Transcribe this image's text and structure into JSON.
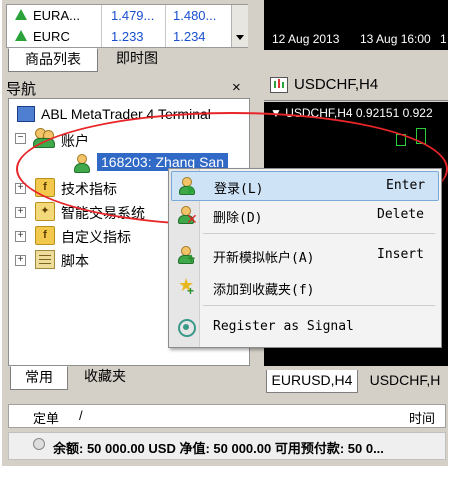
{
  "market_watch": {
    "rows": [
      {
        "symbol": "EURA...",
        "bid": "1.479...",
        "ask": "1.480..."
      },
      {
        "symbol": "EURC",
        "bid": "1.233",
        "ask": "1.234"
      }
    ]
  },
  "left_tabs": [
    "商品列表",
    "即时图"
  ],
  "navigator": {
    "title": "导航",
    "close": "×",
    "root": "ABL MetaTrader 4 Terminal",
    "accounts": "账户",
    "account_item": "168203: Zhang San",
    "items": [
      "技术指标",
      "智能交易系统",
      "自定义指标",
      "脚本"
    ],
    "tabs": [
      "常用",
      "收藏夹"
    ]
  },
  "chart_top": {
    "dates": [
      "12 Aug 2013",
      "13 Aug 16:00",
      "1"
    ]
  },
  "chart2": {
    "title": "USDCHF,H4",
    "header": "▼ USDCHF,H4  0.92151 0.922",
    "tabs": [
      "EURUSD,H4",
      "USDCHF,H"
    ]
  },
  "context_menu": {
    "items": [
      {
        "label": "登录(L)",
        "key": "Enter",
        "icon": "login-icon",
        "highlighted": true
      },
      {
        "label": "删除(D)",
        "key": "Delete",
        "icon": "delete-user-icon"
      },
      {
        "label": "开新模拟帐户(A)",
        "key": "Insert",
        "icon": "add-user-icon"
      },
      {
        "label": "添加到收藏夹(f)",
        "key": "",
        "icon": "star-icon"
      },
      {
        "label": "Register as Signal",
        "key": "",
        "icon": "signal-icon"
      }
    ]
  },
  "terminal": {
    "col_order": "定单",
    "col_sort": "/",
    "col_time": "时间",
    "balance_row": "余额: 50 000.00 USD  净值: 50 000.00  可用预付款: 50 0..."
  },
  "colors": {
    "highlight": "#cfe3f7",
    "annotation": "#e8262a",
    "price": "#1a4fcf"
  }
}
